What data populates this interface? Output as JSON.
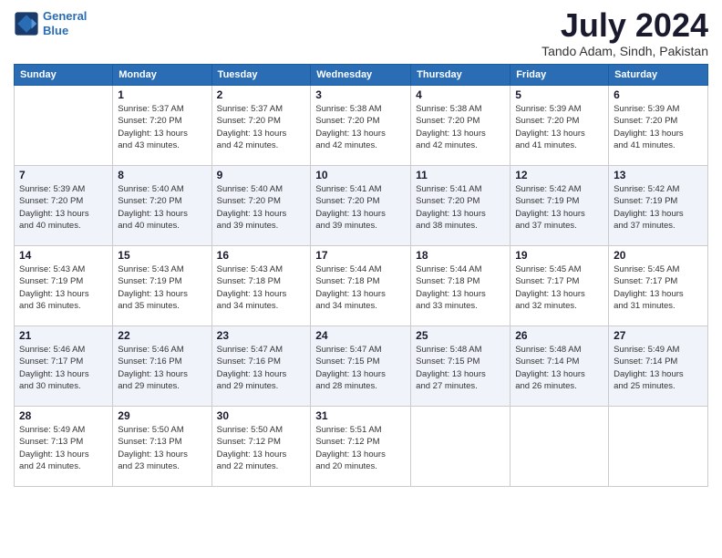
{
  "header": {
    "logo_line1": "General",
    "logo_line2": "Blue",
    "month_year": "July 2024",
    "location": "Tando Adam, Sindh, Pakistan"
  },
  "weekdays": [
    "Sunday",
    "Monday",
    "Tuesday",
    "Wednesday",
    "Thursday",
    "Friday",
    "Saturday"
  ],
  "weeks": [
    [
      {
        "day": "",
        "info": ""
      },
      {
        "day": "1",
        "info": "Sunrise: 5:37 AM\nSunset: 7:20 PM\nDaylight: 13 hours\nand 43 minutes."
      },
      {
        "day": "2",
        "info": "Sunrise: 5:37 AM\nSunset: 7:20 PM\nDaylight: 13 hours\nand 42 minutes."
      },
      {
        "day": "3",
        "info": "Sunrise: 5:38 AM\nSunset: 7:20 PM\nDaylight: 13 hours\nand 42 minutes."
      },
      {
        "day": "4",
        "info": "Sunrise: 5:38 AM\nSunset: 7:20 PM\nDaylight: 13 hours\nand 42 minutes."
      },
      {
        "day": "5",
        "info": "Sunrise: 5:39 AM\nSunset: 7:20 PM\nDaylight: 13 hours\nand 41 minutes."
      },
      {
        "day": "6",
        "info": "Sunrise: 5:39 AM\nSunset: 7:20 PM\nDaylight: 13 hours\nand 41 minutes."
      }
    ],
    [
      {
        "day": "7",
        "info": "Sunrise: 5:39 AM\nSunset: 7:20 PM\nDaylight: 13 hours\nand 40 minutes."
      },
      {
        "day": "8",
        "info": "Sunrise: 5:40 AM\nSunset: 7:20 PM\nDaylight: 13 hours\nand 40 minutes."
      },
      {
        "day": "9",
        "info": "Sunrise: 5:40 AM\nSunset: 7:20 PM\nDaylight: 13 hours\nand 39 minutes."
      },
      {
        "day": "10",
        "info": "Sunrise: 5:41 AM\nSunset: 7:20 PM\nDaylight: 13 hours\nand 39 minutes."
      },
      {
        "day": "11",
        "info": "Sunrise: 5:41 AM\nSunset: 7:20 PM\nDaylight: 13 hours\nand 38 minutes."
      },
      {
        "day": "12",
        "info": "Sunrise: 5:42 AM\nSunset: 7:19 PM\nDaylight: 13 hours\nand 37 minutes."
      },
      {
        "day": "13",
        "info": "Sunrise: 5:42 AM\nSunset: 7:19 PM\nDaylight: 13 hours\nand 37 minutes."
      }
    ],
    [
      {
        "day": "14",
        "info": "Sunrise: 5:43 AM\nSunset: 7:19 PM\nDaylight: 13 hours\nand 36 minutes."
      },
      {
        "day": "15",
        "info": "Sunrise: 5:43 AM\nSunset: 7:19 PM\nDaylight: 13 hours\nand 35 minutes."
      },
      {
        "day": "16",
        "info": "Sunrise: 5:43 AM\nSunset: 7:18 PM\nDaylight: 13 hours\nand 34 minutes."
      },
      {
        "day": "17",
        "info": "Sunrise: 5:44 AM\nSunset: 7:18 PM\nDaylight: 13 hours\nand 34 minutes."
      },
      {
        "day": "18",
        "info": "Sunrise: 5:44 AM\nSunset: 7:18 PM\nDaylight: 13 hours\nand 33 minutes."
      },
      {
        "day": "19",
        "info": "Sunrise: 5:45 AM\nSunset: 7:17 PM\nDaylight: 13 hours\nand 32 minutes."
      },
      {
        "day": "20",
        "info": "Sunrise: 5:45 AM\nSunset: 7:17 PM\nDaylight: 13 hours\nand 31 minutes."
      }
    ],
    [
      {
        "day": "21",
        "info": "Sunrise: 5:46 AM\nSunset: 7:17 PM\nDaylight: 13 hours\nand 30 minutes."
      },
      {
        "day": "22",
        "info": "Sunrise: 5:46 AM\nSunset: 7:16 PM\nDaylight: 13 hours\nand 29 minutes."
      },
      {
        "day": "23",
        "info": "Sunrise: 5:47 AM\nSunset: 7:16 PM\nDaylight: 13 hours\nand 29 minutes."
      },
      {
        "day": "24",
        "info": "Sunrise: 5:47 AM\nSunset: 7:15 PM\nDaylight: 13 hours\nand 28 minutes."
      },
      {
        "day": "25",
        "info": "Sunrise: 5:48 AM\nSunset: 7:15 PM\nDaylight: 13 hours\nand 27 minutes."
      },
      {
        "day": "26",
        "info": "Sunrise: 5:48 AM\nSunset: 7:14 PM\nDaylight: 13 hours\nand 26 minutes."
      },
      {
        "day": "27",
        "info": "Sunrise: 5:49 AM\nSunset: 7:14 PM\nDaylight: 13 hours\nand 25 minutes."
      }
    ],
    [
      {
        "day": "28",
        "info": "Sunrise: 5:49 AM\nSunset: 7:13 PM\nDaylight: 13 hours\nand 24 minutes."
      },
      {
        "day": "29",
        "info": "Sunrise: 5:50 AM\nSunset: 7:13 PM\nDaylight: 13 hours\nand 23 minutes."
      },
      {
        "day": "30",
        "info": "Sunrise: 5:50 AM\nSunset: 7:12 PM\nDaylight: 13 hours\nand 22 minutes."
      },
      {
        "day": "31",
        "info": "Sunrise: 5:51 AM\nSunset: 7:12 PM\nDaylight: 13 hours\nand 20 minutes."
      },
      {
        "day": "",
        "info": ""
      },
      {
        "day": "",
        "info": ""
      },
      {
        "day": "",
        "info": ""
      }
    ]
  ]
}
